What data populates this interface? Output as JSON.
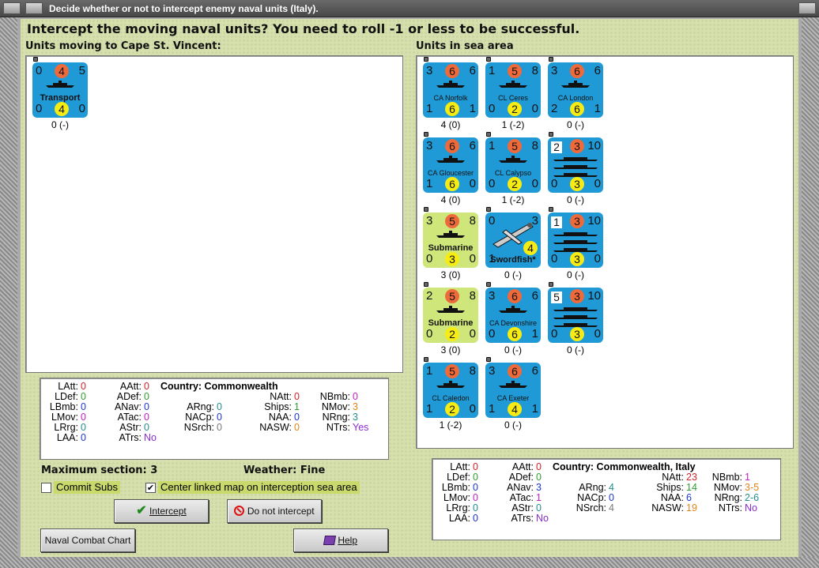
{
  "window": {
    "title": "Decide whether or not to intercept enemy naval units (Italy)."
  },
  "question": "Intercept the moving naval units?  You need to roll -1 or less to be successful.",
  "moving": {
    "header": "Units moving to Cape St. Vincent:",
    "units": [
      {
        "name": "Transport",
        "tl": "0",
        "tc": "4",
        "tr": "5",
        "bl": "0",
        "bc": "4",
        "br": "0",
        "caption": "0 (-)"
      }
    ]
  },
  "sea": {
    "header": "Units in sea area",
    "units": [
      {
        "name": "CA Norfolk",
        "tl": "3",
        "tc": "6",
        "tr": "6",
        "bl": "1",
        "bc": "6",
        "br": "1",
        "caption": "4 (0)"
      },
      {
        "name": "CL Ceres",
        "tl": "1",
        "tc": "5",
        "tr": "8",
        "bl": "0",
        "bc": "2",
        "br": "0",
        "caption": "1 (-2)"
      },
      {
        "name": "CA London",
        "tl": "3",
        "tc": "6",
        "tr": "6",
        "bl": "2",
        "bc": "6",
        "br": "1",
        "caption": "0 (-)"
      },
      {
        "name": "CA Gloucester",
        "tl": "3",
        "tc": "6",
        "tr": "6",
        "bl": "1",
        "bc": "6",
        "br": "0",
        "caption": "4 (0)"
      },
      {
        "name": "CL Calypso",
        "tl": "1",
        "tc": "5",
        "tr": "8",
        "bl": "0",
        "bc": "2",
        "br": "0",
        "caption": "1 (-2)"
      },
      {
        "name": "",
        "tl": "2",
        "tc": "3",
        "tr": "10",
        "bl": "0",
        "bc": "3",
        "br": "0",
        "caption": "0 (-)"
      },
      {
        "name": "Submarine",
        "tl": "3",
        "tc": "5",
        "tr": "8",
        "bl": "0",
        "bc": "3",
        "br": "0",
        "caption": "3 (0)"
      },
      {
        "name": "Swordfish*",
        "tl": "0",
        "tc": "",
        "tr": "3",
        "bl": "1",
        "bc": "4",
        "br": "",
        "caption": "0 (-)"
      },
      {
        "name": "",
        "tl": "1",
        "tc": "3",
        "tr": "10",
        "bl": "0",
        "bc": "3",
        "br": "0",
        "caption": "0 (-)"
      },
      {
        "name": "Submarine",
        "tl": "2",
        "tc": "5",
        "tr": "8",
        "bl": "0",
        "bc": "2",
        "br": "0",
        "caption": "3 (0)"
      },
      {
        "name": "CA Devonshire",
        "tl": "3",
        "tc": "6",
        "tr": "6",
        "bl": "0",
        "bc": "6",
        "br": "1",
        "caption": "0 (-)"
      },
      {
        "name": "",
        "tl": "5",
        "tc": "3",
        "tr": "10",
        "bl": "0",
        "bc": "3",
        "br": "0",
        "caption": "0 (-)"
      },
      {
        "name": "CL Caledon",
        "tl": "1",
        "tc": "5",
        "tr": "8",
        "bl": "1",
        "bc": "2",
        "br": "0",
        "caption": "1 (-2)"
      },
      {
        "name": "CA Exeter",
        "tl": "3",
        "tc": "6",
        "tr": "6",
        "bl": "1",
        "bc": "4",
        "br": "1",
        "caption": "0 (-)"
      }
    ]
  },
  "leftStats": {
    "country_label": "Country: Commonwealth",
    "LAtt": "0",
    "LDef": "0",
    "LBmb": "0",
    "LMov": "0",
    "LRrg": "0",
    "LAA": "0",
    "AAtt": "0",
    "ADef": "0",
    "ANav": "0",
    "ATac": "0",
    "AStr": "0",
    "ATrs": "No",
    "ARng": "0",
    "NACp": "0",
    "NSrch": "0",
    "NAtt": "0",
    "Ships": "1",
    "NAA": "0",
    "NASW": "0",
    "NBmb": "0",
    "NMov": "3",
    "NRng": "3",
    "NTrs": "Yes"
  },
  "rightStats": {
    "country_label": "Country: Commonwealth, Italy",
    "LAtt": "0",
    "LDef": "0",
    "LBmb": "0",
    "LMov": "0",
    "LRrg": "0",
    "LAA": "0",
    "AAtt": "0",
    "ADef": "0",
    "ANav": "3",
    "ATac": "1",
    "AStr": "0",
    "ATrs": "No",
    "ARng": "4",
    "NACp": "0",
    "NSrch": "4",
    "NAtt": "23",
    "Ships": "14",
    "NAA": "6",
    "NASW": "19",
    "NBmb": "1",
    "NMov": "3-5",
    "NRng": "2-6",
    "NTrs": "No"
  },
  "labels": {
    "LAtt": "LAtt:",
    "LDef": "LDef:",
    "LBmb": "LBmb:",
    "LMov": "LMov:",
    "LRrg": "LRrg:",
    "LAA": "LAA:",
    "AAtt": "AAtt:",
    "ADef": "ADef:",
    "ANav": "ANav:",
    "ATac": "ATac:",
    "AStr": "AStr:",
    "ATrs": "ATrs:",
    "ARng": "ARng:",
    "NACp": "NACp:",
    "NSrch": "NSrch:",
    "NAtt": "NAtt:",
    "Ships": "Ships:",
    "NAA": "NAA:",
    "NASW": "NASW:",
    "NBmb": "NBmb:",
    "NMov": "NMov:",
    "NRng": "NRng:",
    "NTrs": "NTrs:"
  },
  "info": {
    "max_section": "Maximum section: 3",
    "weather": "Weather:  Fine"
  },
  "options": {
    "commit_subs": "Commit Subs",
    "center_map": "Center linked map on interception sea area"
  },
  "buttons": {
    "intercept": "Intercept",
    "no_intercept": "Do not intercept",
    "naval_chart": "Naval Combat Chart",
    "help": "Help"
  },
  "colors": {
    "counter_blue": "#1f9ad6",
    "counter_green": "#cfe67a",
    "attack_circle": "#ee6a3b",
    "move_circle": "#f6ec14",
    "bg": "#d6dfae"
  }
}
